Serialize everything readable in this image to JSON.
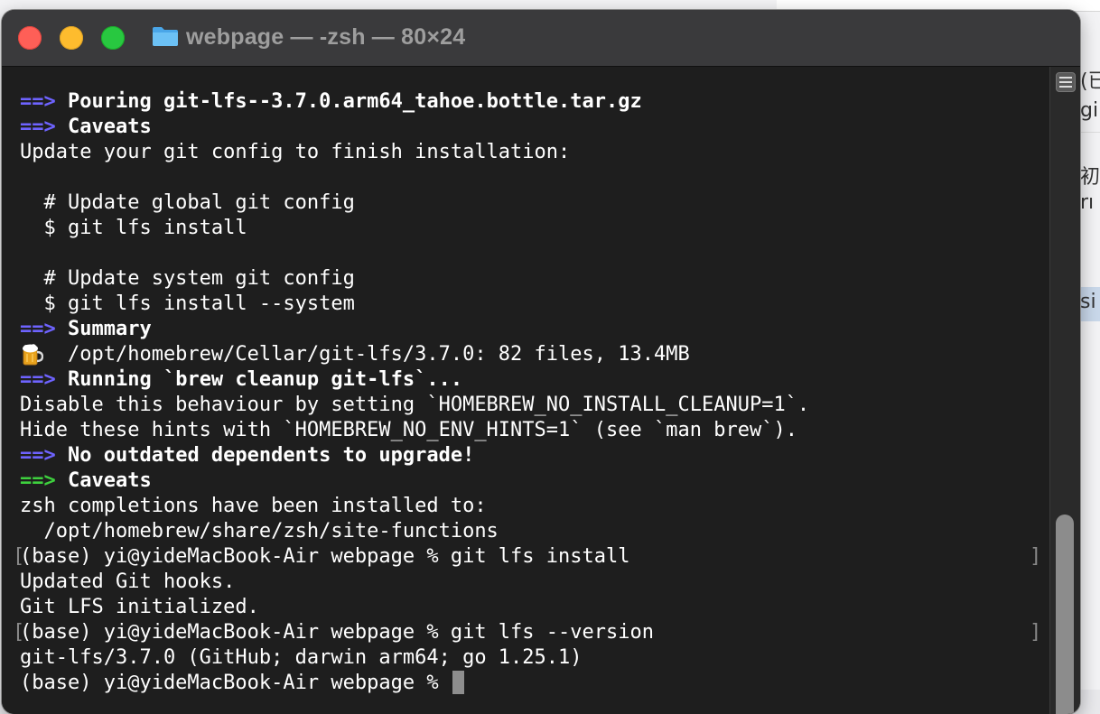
{
  "window": {
    "title": "webpage — -zsh — 80×24"
  },
  "background_doc": {
    "fragments": [
      "(已",
      "gi",
      "初始",
      "rı",
      "si"
    ]
  },
  "terminal": {
    "lines": [
      {
        "prefix": "==>",
        "prefix_color": "blue",
        "text": " Pouring git-lfs--3.7.0.arm64_tahoe.bottle.tar.gz",
        "bold": true
      },
      {
        "prefix": "==>",
        "prefix_color": "blue",
        "text": " Caveats",
        "bold": true
      },
      {
        "prefix": "",
        "text": "Update your git config to finish installation:"
      },
      {
        "prefix": "",
        "text": ""
      },
      {
        "prefix": "",
        "text": "  # Update global git config"
      },
      {
        "prefix": "",
        "text": "  $ git lfs install"
      },
      {
        "prefix": "",
        "text": ""
      },
      {
        "prefix": "",
        "text": "  # Update system git config"
      },
      {
        "prefix": "",
        "text": "  $ git lfs install --system"
      },
      {
        "prefix": "==>",
        "prefix_color": "blue",
        "text": " Summary",
        "bold": true
      },
      {
        "prefix": "",
        "text": "    /opt/homebrew/Cellar/git-lfs/3.7.0: 82 files, 13.4MB",
        "icon": "beer-mug-icon"
      },
      {
        "prefix": "==>",
        "prefix_color": "blue",
        "text": " Running `brew cleanup git-lfs`...",
        "bold": true
      },
      {
        "prefix": "",
        "text": "Disable this behaviour by setting `HOMEBREW_NO_INSTALL_CLEANUP=1`."
      },
      {
        "prefix": "",
        "text": "Hide these hints with `HOMEBREW_NO_ENV_HINTS=1` (see `man brew`)."
      },
      {
        "prefix": "==>",
        "prefix_color": "blue",
        "text": " No outdated dependents to upgrade!",
        "bold": true
      },
      {
        "prefix": "==>",
        "prefix_color": "green",
        "text": " Caveats",
        "bold": true
      },
      {
        "prefix": "",
        "text": "zsh completions have been installed to:"
      },
      {
        "prefix": "",
        "text": "  /opt/homebrew/share/zsh/site-functions"
      },
      {
        "prefix": "",
        "text": "(base) yi@yideMacBook-Air webpage % git lfs install",
        "marked": true
      },
      {
        "prefix": "",
        "text": "Updated Git hooks."
      },
      {
        "prefix": "",
        "text": "Git LFS initialized."
      },
      {
        "prefix": "",
        "text": "(base) yi@yideMacBook-Air webpage % git lfs --version",
        "marked": true
      },
      {
        "prefix": "",
        "text": "git-lfs/3.7.0 (GitHub; darwin arm64; go 1.25.1)"
      },
      {
        "prefix": "",
        "text": "(base) yi@yideMacBook-Air webpage % ",
        "cursor": true
      }
    ]
  },
  "colors": {
    "arrow_blue": "#6e63ff",
    "arrow_green": "#3ed03e",
    "terminal_bg": "#1e1e1e",
    "text": "#ffffff"
  }
}
